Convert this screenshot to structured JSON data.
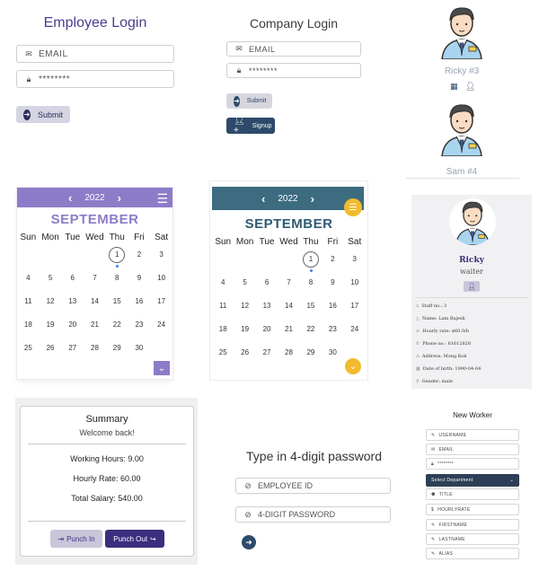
{
  "employee_login": {
    "title": "Employee Login",
    "email_placeholder": "EMAIL",
    "password_value": "********",
    "submit_label": "Submit"
  },
  "company_login": {
    "title": "Company Login",
    "email_placeholder": "EMAIL",
    "password_value": "********",
    "submit_label": "Submit",
    "signup_label": "Signup"
  },
  "worker_list": [
    {
      "name": "Ricky #3"
    },
    {
      "name": "Sam #4"
    }
  ],
  "calendar_purple": {
    "year": "2022",
    "month": "SEPTEMBER",
    "weekdays": [
      "Sun",
      "Mon",
      "Tue",
      "Wed",
      "Thu",
      "Fri",
      "Sat"
    ],
    "days": [
      "",
      "",
      "",
      "",
      "1",
      "2",
      "3",
      "4",
      "5",
      "6",
      "7",
      "8",
      "9",
      "10",
      "11",
      "12",
      "13",
      "14",
      "15",
      "16",
      "17",
      "18",
      "19",
      "20",
      "21",
      "22",
      "23",
      "24",
      "25",
      "26",
      "27",
      "28",
      "29",
      "30",
      ""
    ],
    "today": "1",
    "accent": "#8c7cc8"
  },
  "calendar_teal": {
    "year": "2022",
    "month": "SEPTEMBER",
    "weekdays": [
      "Sun",
      "Mon",
      "Tue",
      "Wed",
      "Thu",
      "Fri",
      "Sat"
    ],
    "days": [
      "",
      "",
      "",
      "",
      "1",
      "2",
      "3",
      "4",
      "5",
      "6",
      "7",
      "8",
      "9",
      "10",
      "11",
      "12",
      "13",
      "14",
      "15",
      "16",
      "17",
      "18",
      "19",
      "20",
      "21",
      "22",
      "23",
      "24",
      "25",
      "26",
      "27",
      "28",
      "29",
      "30",
      ""
    ],
    "today": "1",
    "accent": "#3d6b80",
    "fab_color": "#f2bb2d"
  },
  "worker_card": {
    "name": "Ricky",
    "role": "waiter",
    "staff_no": "Staff no.: 3",
    "name_line": "Name: Lam Bajesh",
    "hourly_rate": "Hourly rate: $60.0/h",
    "phone": "Phone no.: 61612828",
    "address": "Address: Mong Kok",
    "dob": "Date of birth: 1990-04-04",
    "gender": "Gender: male"
  },
  "summary": {
    "title": "Summary",
    "welcome": "Welcome back!",
    "working_hours": "Working Hours: 9.00",
    "hourly_rate": "Hourly Rate: 60.00",
    "total_salary": "Total Salary: 540.00",
    "punch_in_label": "Punch In",
    "punch_out_label": "Punch Out"
  },
  "password_entry": {
    "title": "Type in 4-digit password",
    "employee_id_placeholder": "EMPLOYEE ID",
    "password_placeholder": "4-DIGIT PASSWORD"
  },
  "new_worker": {
    "title": "New Worker",
    "username_placeholder": "USERNAME",
    "email_placeholder": "EMAIL",
    "password_value": "********",
    "department_select": "Select Department",
    "title_placeholder": "TITLE",
    "hourly_rate_placeholder": "HOURLYRATE",
    "firstname_placeholder": "FIRSTNAME",
    "lastname_placeholder": "LASTNAME",
    "alias_placeholder": "ALIAS"
  },
  "colors": {
    "primary_purple": "#4b3c8f",
    "calendar_purple": "#8c7cc8",
    "calendar_teal": "#3d6b80",
    "punch_out": "#3b2e7e",
    "punch_in": "#c9c6da",
    "dark_blue": "#2d4a6b"
  },
  "icons": [
    "envelope-icon",
    "lock-icon",
    "arrow-right-circle-icon",
    "user-plus-icon",
    "calendar-icon",
    "user-id-icon",
    "menu-icon",
    "chevron-down-icon",
    "eye-off-icon",
    "pencil-icon",
    "dollar-icon",
    "chevron-left-icon",
    "chevron-right-icon"
  ]
}
